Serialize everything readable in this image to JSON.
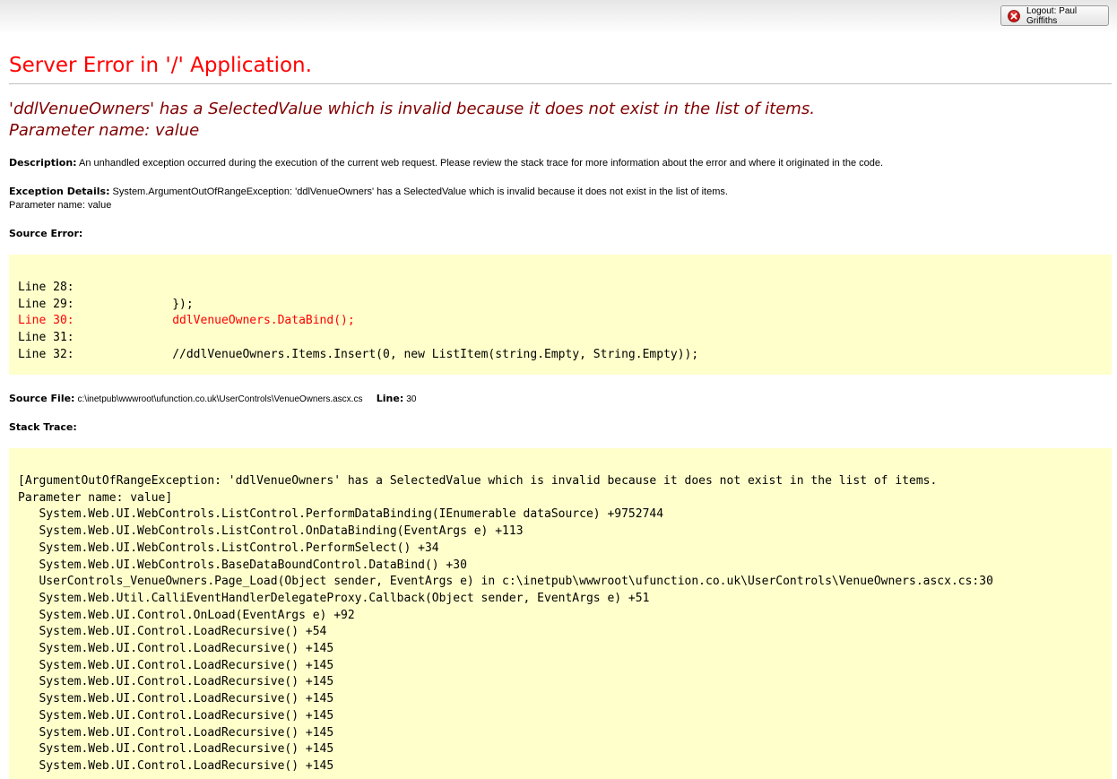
{
  "header": {
    "logout_label": "Logout: Paul Griffiths"
  },
  "page": {
    "title": "Server Error in '/' Application.",
    "error_message_line1": "'ddlVenueOwners' has a SelectedValue which is invalid because it does not exist in the list of items.",
    "error_message_line2": "Parameter name: value"
  },
  "description": {
    "label": "Description:",
    "text": "An unhandled exception occurred during the execution of the current web request. Please review the stack trace for more information about the error and where it originated in the code."
  },
  "exception": {
    "label": "Exception Details:",
    "text": "System.ArgumentOutOfRangeException: 'ddlVenueOwners' has a SelectedValue which is invalid because it does not exist in the list of items.",
    "param": "Parameter name: value"
  },
  "source_error": {
    "label": "Source Error:",
    "lines": [
      {
        "num": "Line 28:",
        "code": ""
      },
      {
        "num": "Line 29:",
        "code": "            });"
      },
      {
        "num": "Line 30:",
        "code": "            ddlVenueOwners.DataBind();",
        "highlight": true
      },
      {
        "num": "Line 31:",
        "code": ""
      },
      {
        "num": "Line 32:",
        "code": "            //ddlVenueOwners.Items.Insert(0, new ListItem(string.Empty, String.Empty));"
      }
    ]
  },
  "source_file": {
    "label": "Source File:",
    "path": "c:\\inetpub\\wwwroot\\ufunction.co.uk\\UserControls\\VenueOwners.ascx.cs",
    "line_label": "Line:",
    "line_value": "30"
  },
  "stack_trace": {
    "label": "Stack Trace:",
    "lines": [
      "[ArgumentOutOfRangeException: 'ddlVenueOwners' has a SelectedValue which is invalid because it does not exist in the list of items.",
      "Parameter name: value]",
      "   System.Web.UI.WebControls.ListControl.PerformDataBinding(IEnumerable dataSource) +9752744",
      "   System.Web.UI.WebControls.ListControl.OnDataBinding(EventArgs e) +113",
      "   System.Web.UI.WebControls.ListControl.PerformSelect() +34",
      "   System.Web.UI.WebControls.BaseDataBoundControl.DataBind() +30",
      "   UserControls_VenueOwners.Page_Load(Object sender, EventArgs e) in c:\\inetpub\\wwwroot\\ufunction.co.uk\\UserControls\\VenueOwners.ascx.cs:30",
      "   System.Web.Util.CalliEventHandlerDelegateProxy.Callback(Object sender, EventArgs e) +51",
      "   System.Web.UI.Control.OnLoad(EventArgs e) +92",
      "   System.Web.UI.Control.LoadRecursive() +54",
      "   System.Web.UI.Control.LoadRecursive() +145",
      "   System.Web.UI.Control.LoadRecursive() +145",
      "   System.Web.UI.Control.LoadRecursive() +145",
      "   System.Web.UI.Control.LoadRecursive() +145",
      "   System.Web.UI.Control.LoadRecursive() +145",
      "   System.Web.UI.Control.LoadRecursive() +145",
      "   System.Web.UI.Control.LoadRecursive() +145",
      "   System.Web.UI.Control.LoadRecursive() +145"
    ]
  },
  "colors": {
    "title": "#ff0000",
    "error_message": "#800000",
    "code_background": "#ffffcc",
    "highlight_line": "#ff0000"
  },
  "icons": {
    "logout": "close-circle-icon"
  }
}
